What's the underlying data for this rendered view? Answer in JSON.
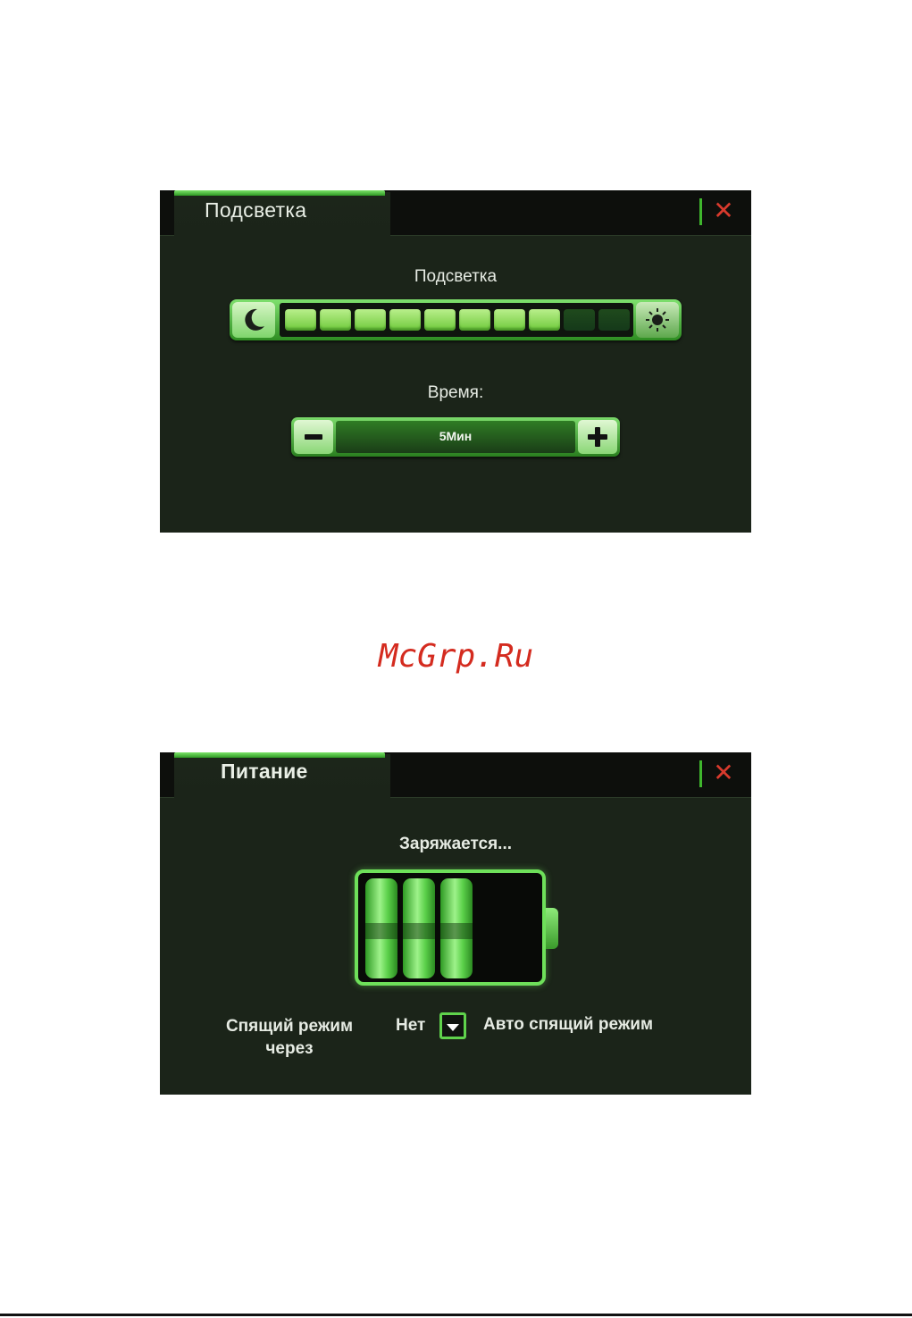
{
  "backlight_window": {
    "tab_title": "Подсветка",
    "close_label": "✕",
    "brightness": {
      "label": "Подсветка",
      "level": 8,
      "max": 10,
      "left_icon": "moon-icon",
      "right_icon": "sun-icon"
    },
    "time": {
      "label": "Время:",
      "value": "5Мин",
      "decrease_icon": "minus-icon",
      "increase_icon": "plus-icon"
    }
  },
  "watermark": "McGrp.Ru",
  "power_window": {
    "tab_title": "Питание",
    "close_label": "✕",
    "status": "Заряжается...",
    "battery": {
      "filled_cells": 3,
      "total_cells": 5
    },
    "sleep_label_line1": "Спящий режим",
    "sleep_label_line2": "через",
    "sleep_value": "Нет",
    "dropdown_icon": "chevron-down-icon",
    "auto_sleep_label": "Авто спящий режим"
  },
  "colors": {
    "accent": "#5fd24c",
    "panel_bg": "#1b2419",
    "close": "#d83a2d",
    "watermark": "#d42b1f"
  }
}
